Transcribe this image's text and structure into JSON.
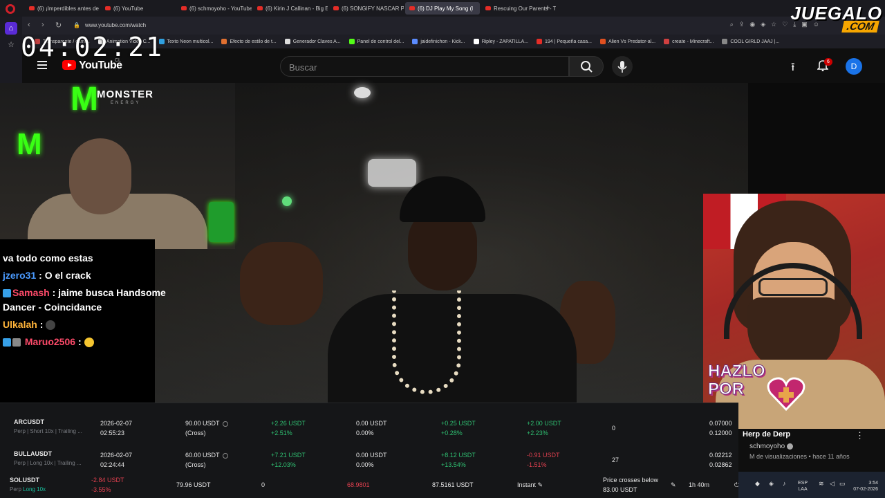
{
  "browser": {
    "tabs": [
      {
        "label": "(6) ¡Imperdibles antes de"
      },
      {
        "label": "(6) YouTube"
      },
      {
        "label": "(6) schmoyoho - YouTube"
      },
      {
        "label": "(6) Kirin J Callinan - Big E"
      },
      {
        "label": "(6) SONGIFY NASCAR PR"
      },
      {
        "label": "(6) DJ Play My Song (l"
      },
      {
        "label": "Rescuing Our Parents - Te"
      }
    ],
    "new_tab_glyph": "+",
    "url": "www.youtube.com/watch",
    "bookmarks": [
      {
        "label": "Transparente / cami...",
        "color": "#c04040"
      },
      {
        "label": "Animation Video C...",
        "color": "#e8e8e8"
      },
      {
        "label": "Texto Neon multicol...",
        "color": "#30a0e0"
      },
      {
        "label": "Efecto de estilo de t...",
        "color": "#e07030"
      },
      {
        "label": "Generador Claves A...",
        "color": "#ddd"
      },
      {
        "label": "Panel de control del...",
        "color": "#53fc18"
      },
      {
        "label": "jaidefinichon - Kick...",
        "color": "#5b8cff"
      },
      {
        "label": "Ripley - ZAPATILLA...",
        "color": "#ffffff"
      },
      {
        "label": "194 | Pequeña casa...",
        "color": "#e52d27"
      },
      {
        "label": "Alien Vs Predator-al...",
        "color": "#e05020"
      },
      {
        "label": "create - Minecraft...",
        "color": "#d04040"
      },
      {
        "label": "COOL GIRLD JAAJ |...",
        "color": "#888"
      }
    ]
  },
  "overlay": {
    "clock": "04:02:21",
    "brand_top": "JUEGALO",
    "brand_bottom": ".COM",
    "monster_word": "MONSTER",
    "monster_sub": "ENERGY"
  },
  "youtube": {
    "logo_text": "YouTube",
    "country": "CL",
    "search_placeholder": "Buscar",
    "notif_count": "6",
    "avatar_letter": "D",
    "video_title": "Herp de Derp",
    "channel": "schmoyoho",
    "views": "M de visualizaciones • hace 11 años"
  },
  "chat": [
    {
      "user": "",
      "msg": "va todo como estas",
      "color": "#fff"
    },
    {
      "user": "jzero31",
      "msg": ": O el crack",
      "color": "#4b9bff"
    },
    {
      "user": "Samash",
      "msg": ": jaime busca Handsome",
      "color": "#ff4b6a"
    },
    {
      "user": "",
      "msg": "Dancer - Coincidance",
      "color": "#fff"
    },
    {
      "user": "Ulkalah",
      "msg": ":",
      "color": "#ffb43a"
    },
    {
      "user": "Maruo2506",
      "msg": ":",
      "color": "#ff4b6a"
    }
  ],
  "art": {
    "line1": "HAZLO",
    "line2": "POR"
  },
  "trades": [
    {
      "symbol": "ARCUSDT",
      "detail": "Perp | Short 10x | Trailing ...",
      "date": "2026-02-07",
      "time": "02:55:23",
      "margin": "90.00 USDT",
      "margin_mode": "(Cross)",
      "pnl_usdt": "+2.26 USDT",
      "pnl_pct": "+2.51%",
      "fee_usdt": "0.00 USDT",
      "fee_pct": "0.00%",
      "upnl_usdt": "+0.25 USDT",
      "upnl_pct": "+0.28%",
      "rpnl_usdt": "+2.00 USDT",
      "rpnl_pct": "+2.23%",
      "count": "0",
      "price1": "0.07000",
      "price2": "0.12000"
    },
    {
      "symbol": "BULLAUSDT",
      "detail": "Perp | Long 10x | Trailing ...",
      "date": "2026-02-07",
      "time": "02:24:44",
      "margin": "60.00 USDT",
      "margin_mode": "(Cross)",
      "pnl_usdt": "+7.21 USDT",
      "pnl_pct": "+12.03%",
      "fee_usdt": "0.00 USDT",
      "fee_pct": "0.00%",
      "upnl_usdt": "+8.12 USDT",
      "upnl_pct": "+13.54%",
      "rpnl_usdt": "-0.91 USDT",
      "rpnl_pct": "-1.51%",
      "count": "27",
      "price1": "0.02212",
      "price2": "0.02862"
    }
  ],
  "order": {
    "symbol": "SOLUSDT",
    "detail_perp": "Perp",
    "detail_long": "Long 10x",
    "pnl": "-2.84 USDT",
    "pnl_pct": "-3.55%",
    "amount": "79.96 USDT",
    "zero": "0",
    "price": "68.9801",
    "entry": "87.5161 USDT",
    "type": "Instant",
    "condition": "Price crosses below",
    "condition_value": "83.00 USDT",
    "duration": "1h 40m"
  },
  "taskbar": {
    "lang1": "ESP",
    "lang2": "LAA",
    "time": "3:54",
    "date": "07-02-2026"
  },
  "colors": {
    "accent": "#5a2bd6",
    "profit": "#2fbf71",
    "loss": "#e0404f",
    "youtube_red": "#ff0000"
  }
}
